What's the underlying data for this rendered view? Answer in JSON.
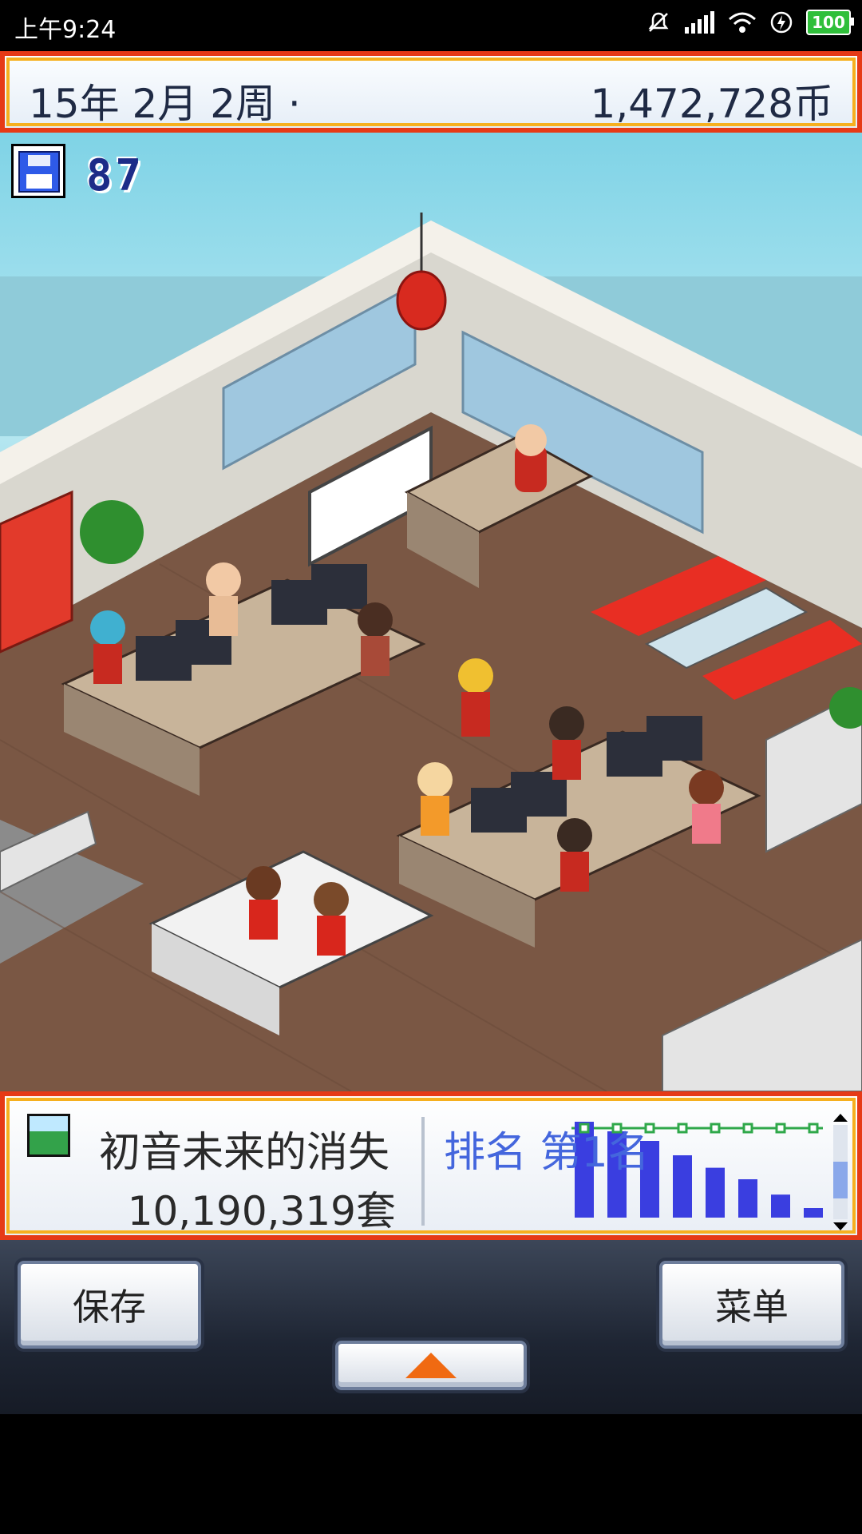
{
  "status_bar": {
    "time": "上午9:24",
    "battery": "100",
    "icons": [
      "mute-icon",
      "signal-icon",
      "wifi-icon",
      "charging-icon",
      "battery-icon"
    ]
  },
  "top_bar": {
    "date": "15年 2月 2周 ·",
    "money": "1,472,728币"
  },
  "scene": {
    "save_count": "87",
    "icons": [
      "floppy-disk-icon"
    ]
  },
  "info_panel": {
    "game_title": "初音未来的消失",
    "sales": "10,190,319套",
    "rank_label": "排名 第1名",
    "rank_chart_values": [
      10,
      9,
      8,
      6.5,
      5.2,
      4,
      2.4,
      1
    ]
  },
  "buttons": {
    "save": "保存",
    "menu": "菜单"
  },
  "colors": {
    "frame_red": "#e63a16",
    "frame_gold": "#f6b01e",
    "rank_blue": "#3a3ee0",
    "arrow_orange": "#f06a12"
  }
}
